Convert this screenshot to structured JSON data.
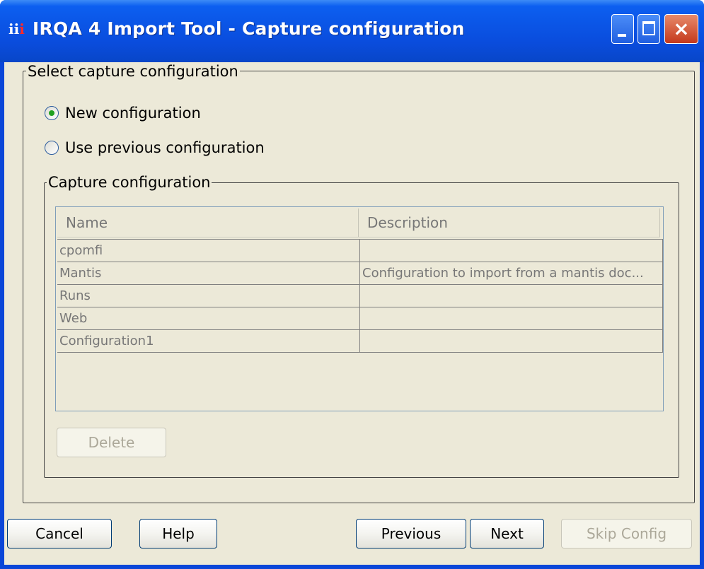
{
  "window": {
    "title": "IRQA 4 Import Tool  - Capture configuration",
    "icon": "iii-app-icon",
    "controls": {
      "minimize": "minimize-icon",
      "maximize": "maximize-icon",
      "close": "×"
    }
  },
  "select_group": {
    "legend": "Select capture configuration",
    "options": [
      {
        "label": "New configuration",
        "checked": true
      },
      {
        "label": "Use previous configuration",
        "checked": false
      }
    ]
  },
  "capture_group": {
    "legend": "Capture configuration",
    "columns": [
      "Name",
      "Description"
    ],
    "rows": [
      {
        "name": "cpomfi",
        "description": ""
      },
      {
        "name": "Mantis",
        "description": "Configuration to import from a mantis doc..."
      },
      {
        "name": "Runs",
        "description": ""
      },
      {
        "name": "Web",
        "description": ""
      },
      {
        "name": "Configuration1",
        "description": ""
      }
    ],
    "delete_label": "Delete"
  },
  "footer": {
    "cancel": "Cancel",
    "help": "Help",
    "previous": "Previous",
    "next": "Next",
    "skip": "Skip Config"
  },
  "colors": {
    "titlebar": "#0a4cdc",
    "dialog_bg": "#ece9d8",
    "radio_dot": "#21a121"
  }
}
